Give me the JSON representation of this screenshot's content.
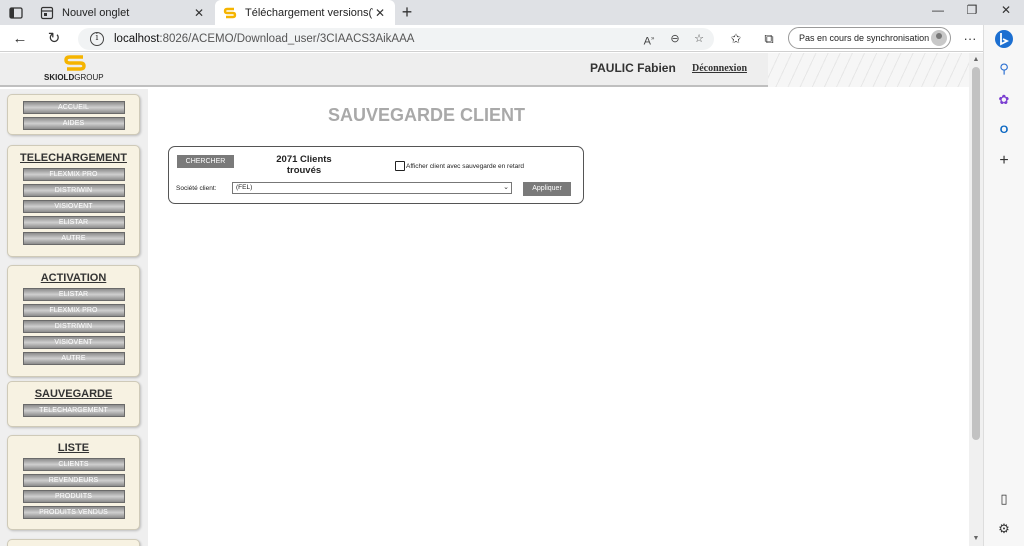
{
  "browser": {
    "tabs": [
      {
        "title": "Nouvel onglet",
        "favicon": "page-icon"
      },
      {
        "title": "Téléchargement versions(Version",
        "favicon": "skiold-s-icon"
      }
    ],
    "url_host": "localhost",
    "url_rest": ":8026/ACEMO/Download_user/3CIAACS3AikAAA",
    "sync_label": "Pas en cours de synchronisation"
  },
  "header": {
    "logo_bold": "SKIOLD",
    "logo_rest": "GROUP",
    "user_name": "PAULIC Fabien",
    "logout_label": "Déconnexion"
  },
  "menu": {
    "top": {
      "items": [
        "ACCUEIL",
        "AIDES"
      ]
    },
    "telechargement": {
      "title": "TELECHARGEMENT",
      "items": [
        "FLEXMIX PRO",
        "DISTRIWIN",
        "VISIOVENT",
        "ELISTAR",
        "AUTRE"
      ]
    },
    "activation": {
      "title": "ACTIVATION",
      "items": [
        "ELISTAR",
        "FLEXMIX PRO",
        "DISTRIWIN",
        "VISIOVENT",
        "AUTRE"
      ]
    },
    "sauvegarde": {
      "title": "SAUVEGARDE",
      "items": [
        "TELECHARGEMENT"
      ]
    },
    "liste": {
      "title": "LISTE",
      "items": [
        "CLIENTS",
        "REVENDEURS",
        "PRODUITS",
        "PRODUITS VENDUS"
      ]
    }
  },
  "content": {
    "title": "SAUVEGARDE CLIENT",
    "search_label": "CHERCHER",
    "count_line1": "2071 Clients",
    "count_line2": "trouvés",
    "late_checkbox_label": "Afficher client avec sauvegarde en retard",
    "late_checked": false,
    "company_label": "Société client:",
    "company_value": "(FEL)",
    "apply_label": "Appliquer"
  }
}
